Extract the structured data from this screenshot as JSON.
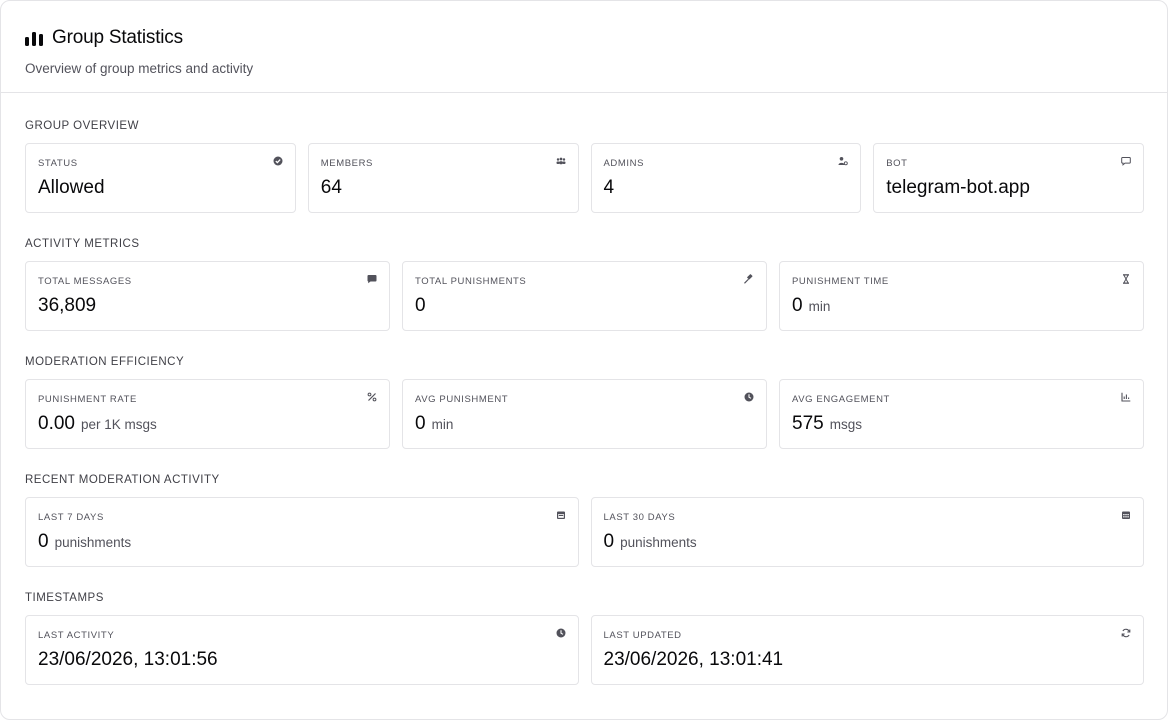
{
  "header": {
    "title": "Group Statistics",
    "subtitle": "Overview of group metrics and activity"
  },
  "sections": {
    "overview": {
      "title": "GROUP OVERVIEW",
      "cards": [
        {
          "label": "STATUS",
          "value": "Allowed",
          "icon": "check-circle-icon"
        },
        {
          "label": "MEMBERS",
          "value": "64",
          "icon": "users-icon"
        },
        {
          "label": "ADMINS",
          "value": "4",
          "icon": "user-cog-icon"
        },
        {
          "label": "BOT",
          "value": "telegram-bot.app",
          "icon": "bot-icon"
        }
      ]
    },
    "activity": {
      "title": "ACTIVITY METRICS",
      "cards": [
        {
          "label": "TOTAL MESSAGES",
          "value": "36,809",
          "unit": "",
          "icon": "message-icon"
        },
        {
          "label": "TOTAL PUNISHMENTS",
          "value": "0",
          "unit": "",
          "icon": "gavel-icon"
        },
        {
          "label": "PUNISHMENT TIME",
          "value": "0",
          "unit": "min",
          "icon": "hourglass-icon"
        }
      ]
    },
    "efficiency": {
      "title": "MODERATION EFFICIENCY",
      "cards": [
        {
          "label": "PUNISHMENT RATE",
          "value": "0.00",
          "unit": "per 1K msgs",
          "icon": "percent-icon"
        },
        {
          "label": "AVG PUNISHMENT",
          "value": "0",
          "unit": "min",
          "icon": "clock-icon"
        },
        {
          "label": "AVG ENGAGEMENT",
          "value": "575",
          "unit": "msgs",
          "icon": "chart-icon"
        }
      ]
    },
    "recent": {
      "title": "RECENT MODERATION ACTIVITY",
      "cards": [
        {
          "label": "LAST 7 DAYS",
          "value": "0",
          "unit": "punishments",
          "icon": "calendar-week-icon"
        },
        {
          "label": "LAST 30 DAYS",
          "value": "0",
          "unit": "punishments",
          "icon": "calendar-month-icon"
        }
      ]
    },
    "timestamps": {
      "title": "TIMESTAMPS",
      "cards": [
        {
          "label": "LAST ACTIVITY",
          "value": "23/06/2026, 13:01:56",
          "icon": "clock-icon"
        },
        {
          "label": "LAST UPDATED",
          "value": "23/06/2026, 13:01:41",
          "icon": "refresh-icon"
        }
      ]
    }
  },
  "colors": {
    "border": "#e4e4e7",
    "text": "#09090b",
    "muted": "#52525b",
    "icon": "#52525b"
  }
}
